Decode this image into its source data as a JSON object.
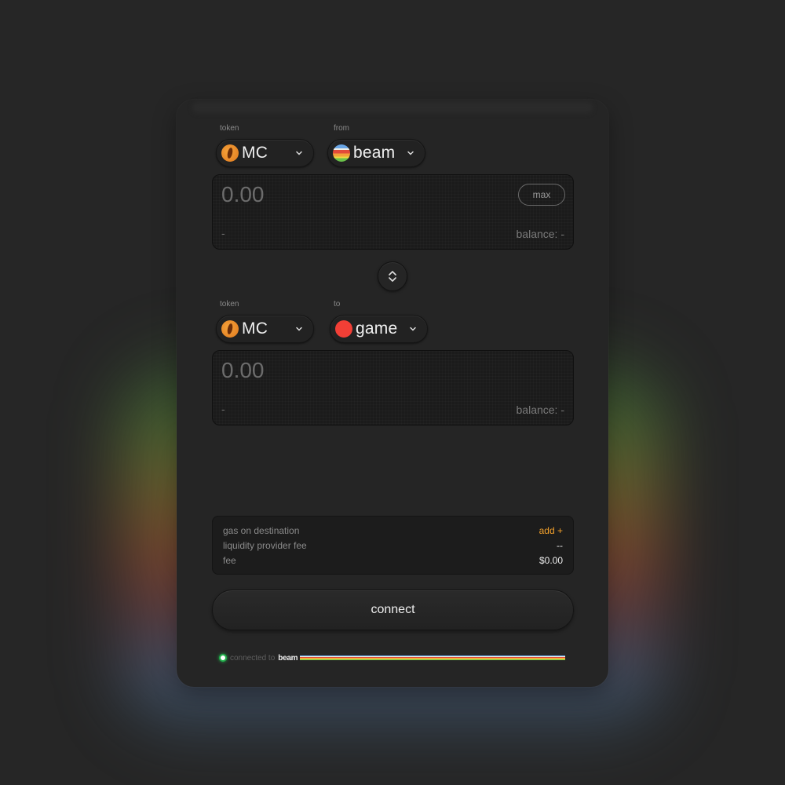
{
  "source": {
    "token_label": "token",
    "chain_label": "from",
    "token": {
      "symbol": "MC",
      "icon": "mc-token-icon"
    },
    "chain": {
      "name": "beam",
      "icon": "beam-chain-icon"
    },
    "amount_placeholder": "0.00",
    "usd_value": "-",
    "balance": "balance: -",
    "max_label": "max"
  },
  "swap": {
    "icon": "swap-direction-icon"
  },
  "destination": {
    "token_label": "token",
    "chain_label": "to",
    "token": {
      "symbol": "MC",
      "icon": "mc-token-icon"
    },
    "chain": {
      "name": "game",
      "icon": "game-chain-icon"
    },
    "amount_placeholder": "0.00",
    "usd_value": "-",
    "balance": "balance: -"
  },
  "fees": [
    {
      "label": "gas on destination",
      "value": "add +",
      "accent": true
    },
    {
      "label": "liquidity provider fee",
      "value": "--"
    },
    {
      "label": "fee",
      "value": "$0.00"
    }
  ],
  "connect_label": "connect",
  "status": {
    "text": "connected to",
    "network": "beam",
    "indicator_color": "#22b14c"
  },
  "colors": {
    "accent": "#f3a12b",
    "game_chain": "#f23f36",
    "mc_token": "#f09a30"
  }
}
